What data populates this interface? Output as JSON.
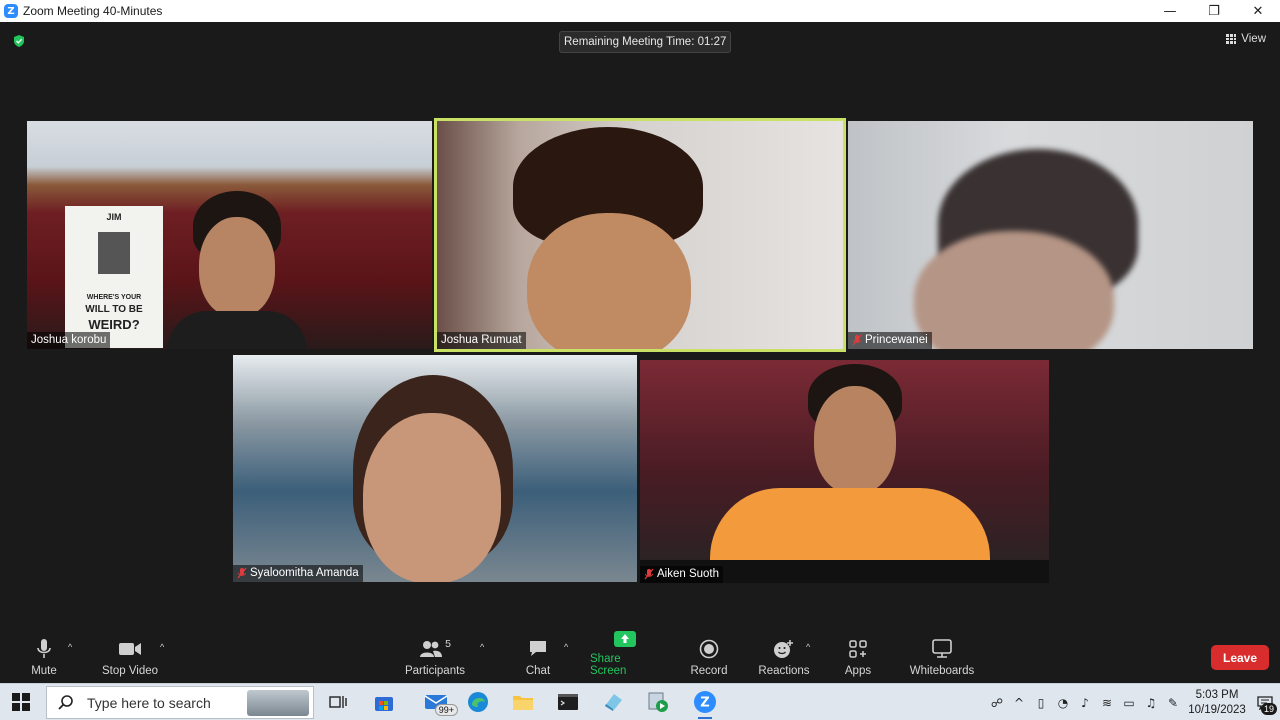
{
  "window": {
    "title": "Zoom Meeting 40-Minutes",
    "controls": [
      "—",
      "❐",
      "✕"
    ]
  },
  "meeting": {
    "timer_label": "Remaining Meeting Time: 01:27",
    "view_label": "View",
    "participants": [
      {
        "name": "Joshua korobu",
        "muted": false,
        "active_speaker": false
      },
      {
        "name": "Joshua Rumuat",
        "muted": false,
        "active_speaker": true
      },
      {
        "name": "Princewanei",
        "muted": true,
        "active_speaker": false
      },
      {
        "name": "Syaloomitha Amanda",
        "muted": true,
        "active_speaker": false
      },
      {
        "name": "Aiken Suoth",
        "muted": true,
        "active_speaker": false
      }
    ],
    "book_text": {
      "brand": "JIM",
      "line1": "WHERE'S YOUR",
      "line2": "WILL TO BE",
      "line3": "WEIRD?"
    }
  },
  "toolbar": {
    "mute": "Mute",
    "stop_video": "Stop Video",
    "participants": "Participants",
    "participants_count": "5",
    "chat": "Chat",
    "share_screen": "Share Screen",
    "record": "Record",
    "reactions": "Reactions",
    "apps": "Apps",
    "whiteboards": "Whiteboards",
    "leave": "Leave"
  },
  "taskbar": {
    "search_placeholder": "Type here to search",
    "mail_badge": "99+",
    "time": "5:03 PM",
    "date": "10/19/2023",
    "notification_count": "19"
  },
  "colors": {
    "active_border": "#c9e265",
    "leave": "#d92d2d",
    "share": "#22c55e",
    "zoom_blue": "#2d8cff"
  }
}
